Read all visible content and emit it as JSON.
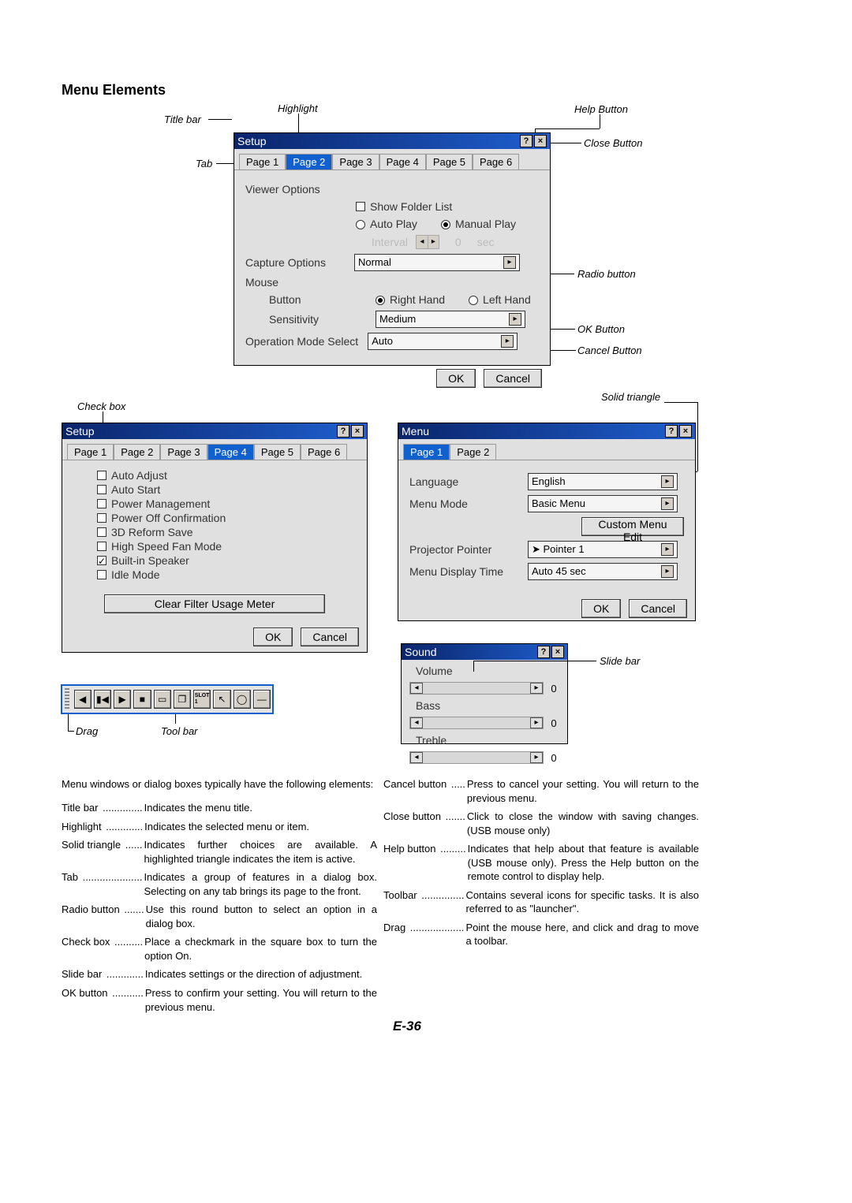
{
  "section_title": "Menu Elements",
  "page_number": "E-36",
  "labels": {
    "title_bar": "Title bar",
    "highlight": "Highlight",
    "help_button": "Help Button",
    "close_button": "Close Button",
    "tab": "Tab",
    "radio_button": "Radio button",
    "ok_button": "OK Button",
    "cancel_button": "Cancel Button",
    "check_box": "Check box",
    "solid_triangle": "Solid triangle",
    "slide_bar": "Slide bar",
    "drag": "Drag",
    "tool_bar": "Tool bar"
  },
  "dialog1": {
    "title": "Setup",
    "tabs": [
      "Page 1",
      "Page 2",
      "Page 3",
      "Page 4",
      "Page 5",
      "Page 6"
    ],
    "active_tab": 1,
    "viewer_label": "Viewer Options",
    "show_folder": "Show Folder List",
    "auto_play": "Auto Play",
    "manual_play": "Manual Play",
    "interval": "Interval",
    "interval_value": "0",
    "interval_unit": "sec",
    "capture_label": "Capture Options",
    "capture_value": "Normal",
    "mouse_label": "Mouse",
    "mouse_button": "Button",
    "right_hand": "Right Hand",
    "left_hand": "Left Hand",
    "sensitivity": "Sensitivity",
    "sensitivity_value": "Medium",
    "op_mode": "Operation Mode Select",
    "op_mode_value": "Auto",
    "ok": "OK",
    "cancel": "Cancel"
  },
  "dialog2": {
    "title": "Setup",
    "tabs": [
      "Page 1",
      "Page 2",
      "Page 3",
      "Page 4",
      "Page 5",
      "Page 6"
    ],
    "active_tab": 3,
    "items": [
      {
        "label": "Auto Adjust",
        "checked": false
      },
      {
        "label": "Auto Start",
        "checked": false
      },
      {
        "label": "Power Management",
        "checked": false
      },
      {
        "label": "Power Off Confirmation",
        "checked": false
      },
      {
        "label": "3D Reform Save",
        "checked": false
      },
      {
        "label": "High Speed Fan Mode",
        "checked": false
      },
      {
        "label": "Built-in Speaker",
        "checked": true
      },
      {
        "label": "Idle Mode",
        "checked": false
      }
    ],
    "clear_filter": "Clear Filter Usage Meter",
    "ok": "OK",
    "cancel": "Cancel"
  },
  "dialog3": {
    "title": "Menu",
    "tabs": [
      "Page 1",
      "Page 2"
    ],
    "active_tab": 0,
    "language_label": "Language",
    "language_value": "English",
    "menu_mode_label": "Menu Mode",
    "menu_mode_value": "Basic Menu",
    "custom_edit": "Custom Menu Edit",
    "pointer_label": "Projector Pointer",
    "pointer_value": "Pointer 1",
    "display_time_label": "Menu Display Time",
    "display_time_value": "Auto 45 sec",
    "ok": "OK",
    "cancel": "Cancel"
  },
  "sound": {
    "title": "Sound",
    "volume": "Volume",
    "bass": "Bass",
    "treble": "Treble",
    "volume_value": "0",
    "bass_value": "0",
    "treble_value": "0"
  },
  "intro": "Menu windows or dialog boxes typically have the following elements:",
  "defs_left": [
    {
      "term": "Title bar",
      "dots": "..............",
      "desc": "Indicates the menu title."
    },
    {
      "term": "Highlight",
      "dots": ".............",
      "desc": "Indicates the selected menu or item."
    },
    {
      "term": "Solid triangle",
      "dots": "......",
      "desc": "Indicates further choices are available. A highlighted triangle indicates the item is active."
    },
    {
      "term": "Tab",
      "dots": ".....................",
      "desc": "Indicates a group of features in a dialog box. Selecting on any tab brings its page to the front."
    },
    {
      "term": "Radio button",
      "dots": ".......",
      "desc": "Use this round button to select an option in a dialog box."
    },
    {
      "term": "Check box",
      "dots": "..........",
      "desc": "Place a checkmark in the square box to turn the option On."
    },
    {
      "term": "Slide bar",
      "dots": ".............",
      "desc": "Indicates settings or the direction of adjustment."
    },
    {
      "term": "OK button",
      "dots": "...........",
      "desc": "Press to confirm your setting. You will return to the previous menu."
    }
  ],
  "defs_right": [
    {
      "term": "Cancel button",
      "dots": ".....",
      "desc": "Press to cancel your setting. You will return to the previous menu."
    },
    {
      "term": "Close button",
      "dots": ".......",
      "desc": "Click to close the window with saving changes. (USB mouse only)"
    },
    {
      "term": "Help button",
      "dots": ".........",
      "desc": "Indicates that help about that feature is available (USB mouse only). Press the Help button on the remote control to display help."
    },
    {
      "term": "Toolbar",
      "dots": "...............",
      "desc": "Contains several icons for specific tasks. It is also referred to as \"launcher\"."
    },
    {
      "term": "Drag",
      "dots": "...................",
      "desc": "Point the mouse here, and click and drag to move a toolbar."
    }
  ]
}
